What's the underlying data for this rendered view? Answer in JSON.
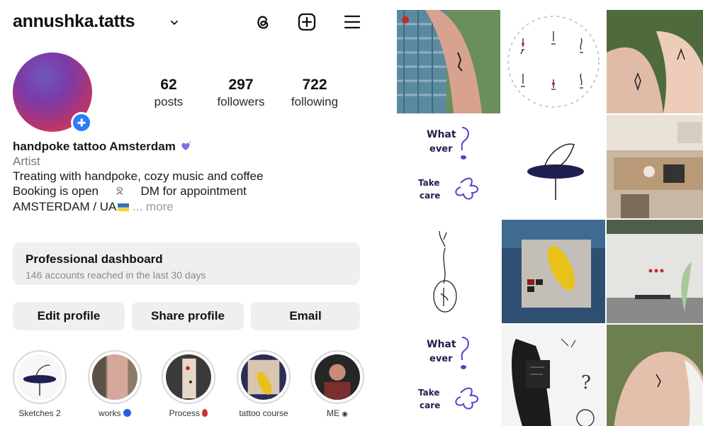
{
  "profile": {
    "username": "annushka.tatts",
    "stats": {
      "posts": {
        "value": "62",
        "label": "posts"
      },
      "followers": {
        "value": "297",
        "label": "followers"
      },
      "following": {
        "value": "722",
        "label": "following"
      }
    },
    "bio": {
      "name": "handpoke tattoo Amsterdam",
      "category": "Artist",
      "line1": "Treating with handpoke, cozy music and coffee",
      "line2_a": "Booking is open",
      "line2_b": "DM for appointment",
      "line3": "AMSTERDAM / UA",
      "more": "... more"
    }
  },
  "dashboard": {
    "title": "Professional dashboard",
    "subtitle": "146 accounts reached in the last 30 days"
  },
  "buttons": {
    "edit": "Edit profile",
    "share": "Share profile",
    "email": "Email"
  },
  "highlights": [
    {
      "label": "Sketches 2"
    },
    {
      "label": "works"
    },
    {
      "label": "Process"
    },
    {
      "label": "tattoo course"
    },
    {
      "label": "ME"
    }
  ],
  "icons": {
    "threads": "threads-icon",
    "add": "add-post-icon",
    "menu": "menu-icon",
    "chevron": "chevron-down-icon"
  },
  "colors": {
    "accent": "#2d7bf6",
    "button_bg": "#efefef"
  },
  "grid_posts": [
    {
      "text_lines": []
    },
    {
      "text_lines": []
    },
    {
      "text_lines": []
    },
    {
      "text_lines": [
        "What",
        "ever",
        "Take",
        "care"
      ]
    },
    {
      "text_lines": []
    },
    {
      "text_lines": []
    },
    {
      "text_lines": []
    },
    {
      "text_lines": []
    },
    {
      "text_lines": []
    },
    {
      "text_lines": [
        "What",
        "ever",
        "Take",
        "care"
      ]
    },
    {
      "text_lines": []
    },
    {
      "text_lines": []
    }
  ]
}
